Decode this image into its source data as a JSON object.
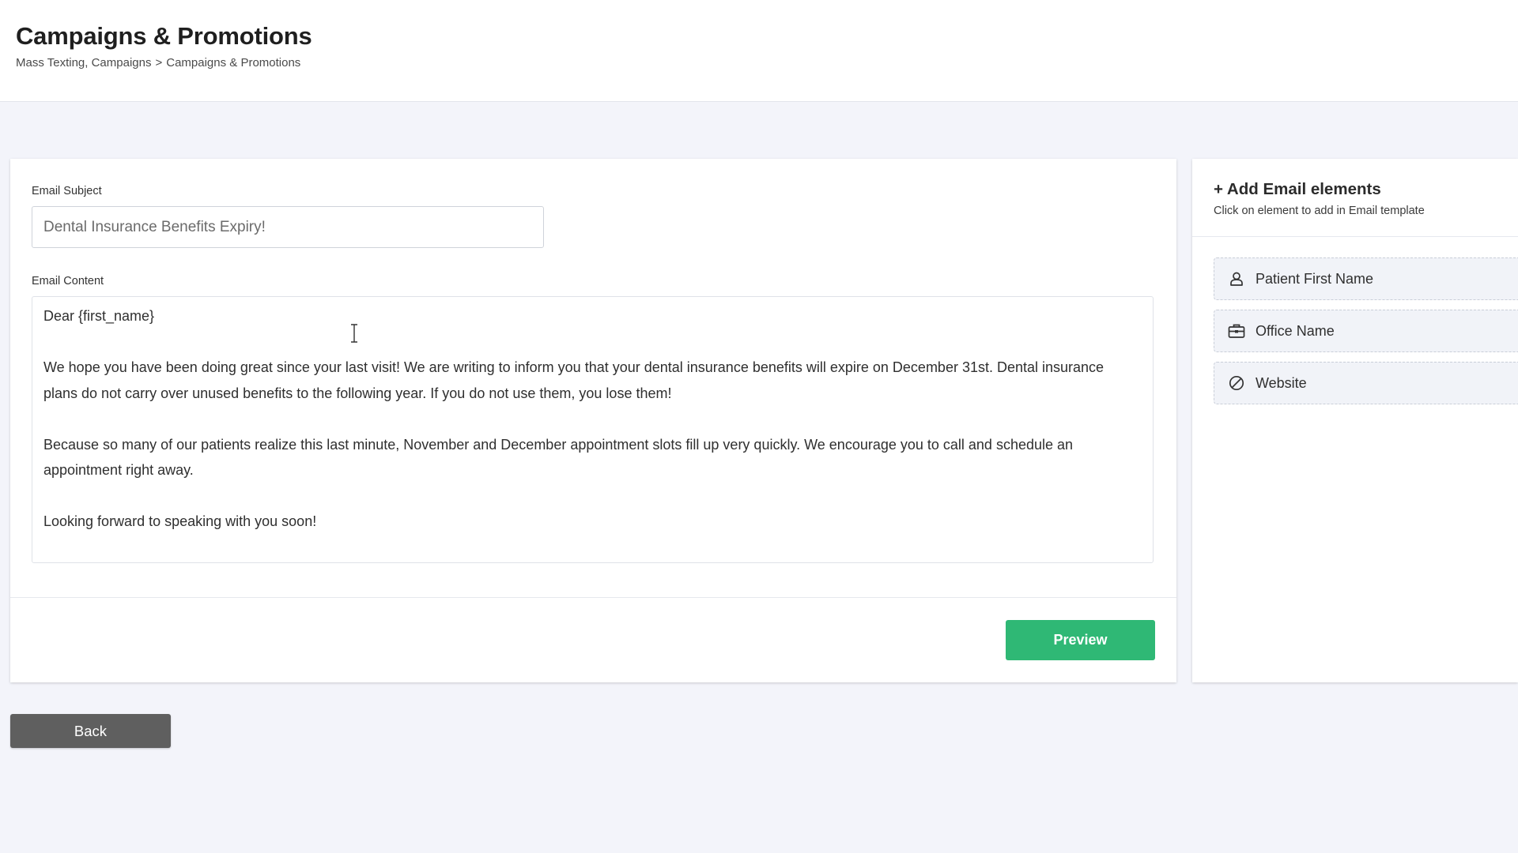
{
  "header": {
    "title": "Campaigns & Promotions",
    "breadcrumb": {
      "parent": "Mass Texting, Campaigns",
      "separator": ">",
      "current": "Campaigns & Promotions"
    }
  },
  "editor": {
    "subject_label": "Email Subject",
    "subject_value": "Dental Insurance Benefits Expiry!",
    "content_label": "Email Content",
    "content_paragraphs": [
      "Dear {first_name}",
      "We hope you have been doing great since your last visit! We are writing to inform you that your dental insurance benefits will expire on December 31st. Dental insurance plans do not carry over unused benefits to the following year. If you do not use them, you lose them!",
      "Because so many of our patients realize this last minute, November and December appointment slots fill up very quickly. We encourage you to call and schedule an appointment right away.",
      "Looking forward to speaking with you soon!"
    ],
    "preview_label": "Preview"
  },
  "elements_panel": {
    "title": "+ Add Email elements",
    "subtitle": "Click on element to add in Email template",
    "items": [
      {
        "label": "Patient First Name",
        "icon": "user-icon"
      },
      {
        "label": "Office Name",
        "icon": "briefcase-icon"
      },
      {
        "label": "Website",
        "icon": "ban-icon"
      }
    ]
  },
  "footer": {
    "back_label": "Back"
  },
  "colors": {
    "page_bg": "#f3f4fa",
    "accent_green": "#2fb875",
    "back_gray": "#5f5f5f"
  }
}
